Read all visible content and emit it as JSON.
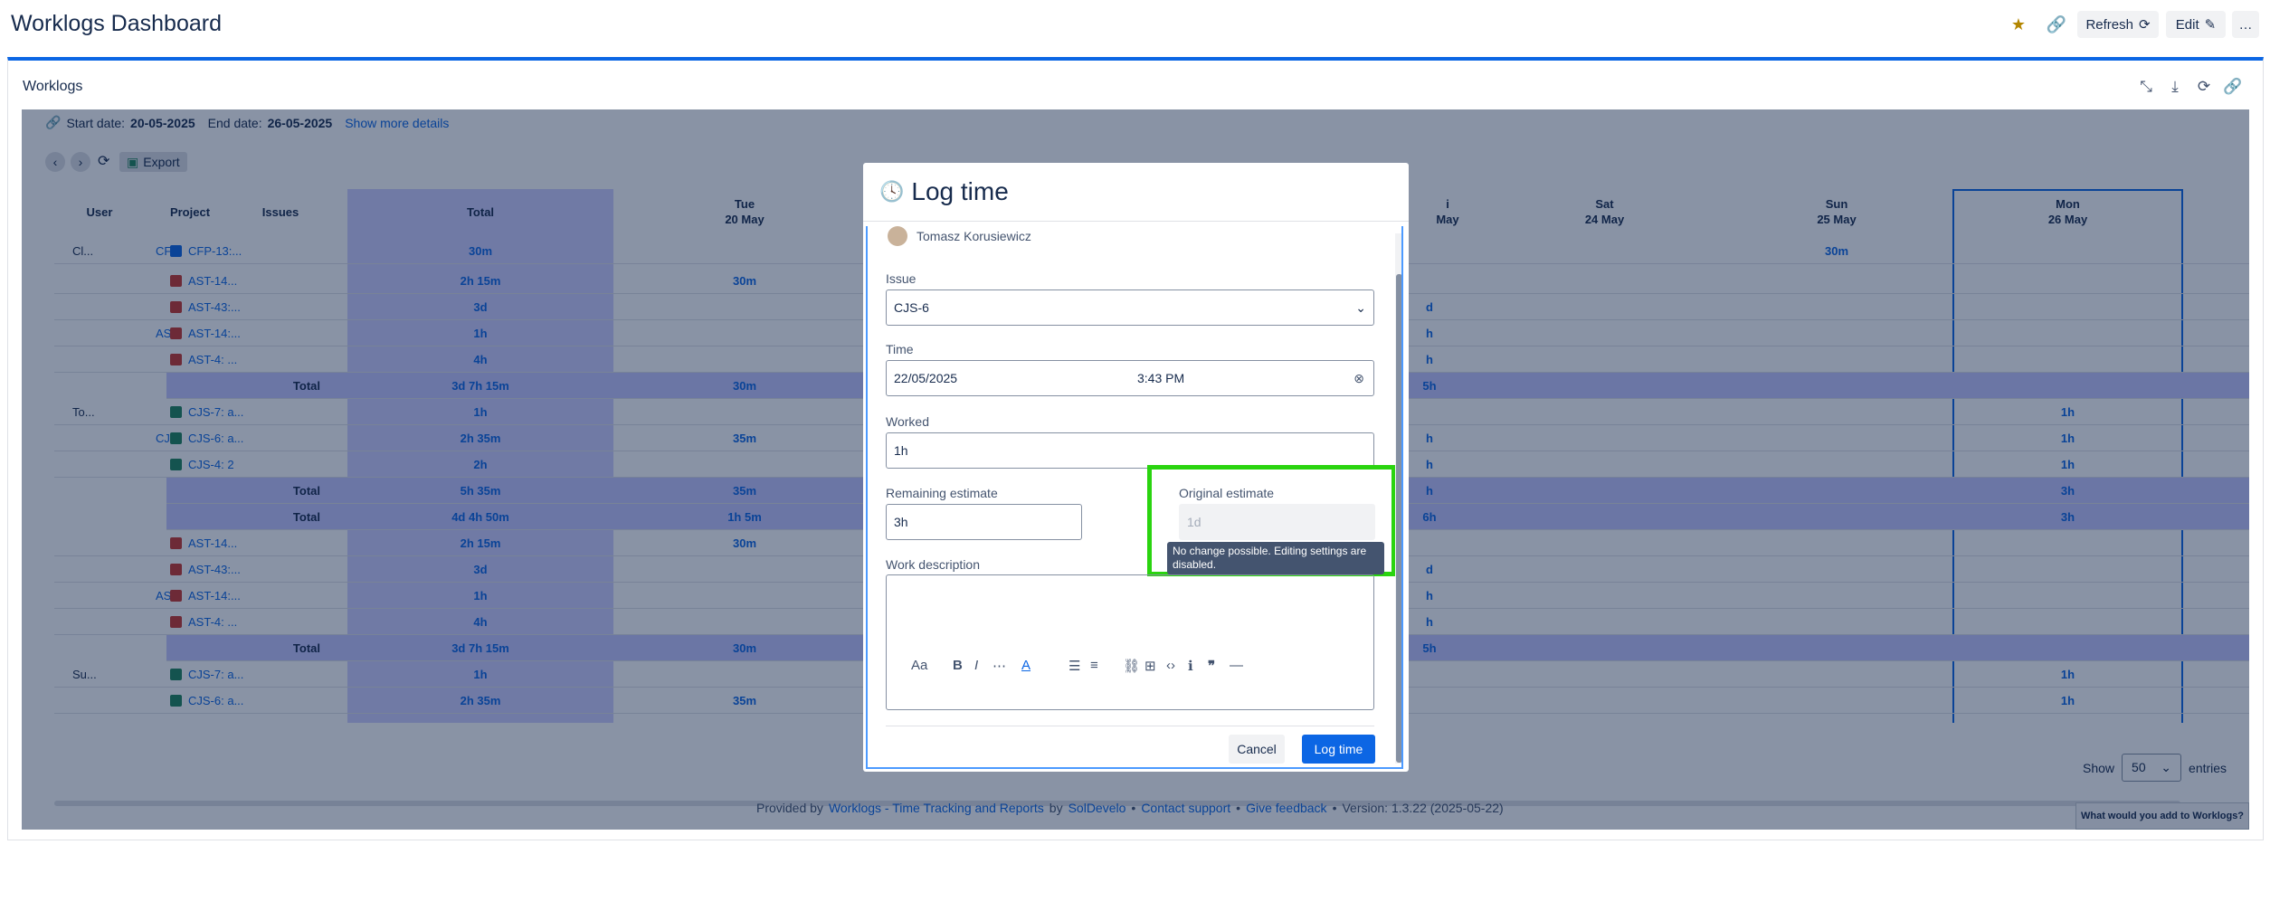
{
  "header": {
    "title": "Worklogs Dashboard",
    "refresh_label": "Refresh",
    "edit_label": "Edit",
    "more_label": "…"
  },
  "gadget": {
    "title": "Worklogs"
  },
  "filters": {
    "start_label": "Start date:",
    "start_value": "20-05-2025",
    "end_label": "End date:",
    "end_value": "26-05-2025",
    "show_more": "Show more details"
  },
  "toolbar": {
    "export_label": "Export"
  },
  "table": {
    "headers": [
      "User",
      "Project",
      "Issues",
      "Total",
      "Tue",
      "20 May",
      "Sat",
      "24 May",
      "Sun",
      "25 May",
      "Mon",
      "26 May"
    ],
    "rows": [
      {
        "user": "Cl...",
        "project": "CFP",
        "issue": "CFP-13:...",
        "total": "30m",
        "tue": "",
        "sun": "30m",
        "mon": ""
      },
      {
        "user": "",
        "project": "",
        "issue": "AST-14...",
        "total": "2h 15m",
        "tue": "30m",
        "sun": "",
        "mon": ""
      },
      {
        "user": "",
        "project": "",
        "issue": "AST-43:...",
        "total": "3d",
        "tue": "",
        "sun": "",
        "mon": ""
      },
      {
        "user": "",
        "project": "AST",
        "issue": "AST-14:...",
        "total": "1h",
        "tue": "",
        "sun": "",
        "mon": ""
      },
      {
        "user": "",
        "project": "",
        "issue": "AST-4: ...",
        "total": "4h",
        "tue": "",
        "sun": "",
        "mon": ""
      },
      {
        "user": "",
        "project": "",
        "issue": "Total",
        "total": "3d 7h 15m",
        "tue": "30m",
        "sun": "",
        "mon": ""
      },
      {
        "user": "To...",
        "project": "",
        "issue": "CJS-7: a...",
        "total": "1h",
        "tue": "",
        "sun": "",
        "mon": "1h"
      },
      {
        "user": "",
        "project": "CJS",
        "issue": "CJS-6: a...",
        "total": "2h 35m",
        "tue": "35m",
        "sun": "",
        "mon": "1h"
      },
      {
        "user": "",
        "project": "",
        "issue": "CJS-4: 2",
        "total": "2h",
        "tue": "",
        "sun": "",
        "mon": "1h"
      },
      {
        "user": "",
        "project": "",
        "issue": "Total",
        "total": "5h 35m",
        "tue": "35m",
        "sun": "",
        "mon": "3h"
      },
      {
        "user": "",
        "project": "",
        "issue": "Total",
        "total": "4d 4h 50m",
        "tue": "1h 5m",
        "sun": "",
        "mon": "3h"
      },
      {
        "user": "",
        "project": "",
        "issue": "AST-14...",
        "total": "2h 15m",
        "tue": "30m",
        "sun": "",
        "mon": ""
      },
      {
        "user": "",
        "project": "",
        "issue": "AST-43:...",
        "total": "3d",
        "tue": "",
        "sun": "",
        "mon": ""
      },
      {
        "user": "",
        "project": "AST",
        "issue": "AST-14:...",
        "total": "1h",
        "tue": "",
        "sun": "",
        "mon": ""
      },
      {
        "user": "",
        "project": "",
        "issue": "AST-4: ...",
        "total": "4h",
        "tue": "",
        "sun": "",
        "mon": ""
      },
      {
        "user": "",
        "project": "",
        "issue": "Total",
        "total": "3d 7h 15m",
        "tue": "30m",
        "sun": "",
        "mon": ""
      },
      {
        "user": "Su...",
        "project": "",
        "issue": "CJS-7: a...",
        "total": "1h",
        "tue": "",
        "sun": "",
        "mon": "1h"
      },
      {
        "user": "",
        "project": "",
        "issue": "CJS-6: a...",
        "total": "2h 35m",
        "tue": "35m",
        "sun": "",
        "mon": "1h"
      }
    ],
    "partial_col": {
      "header": "i",
      "header2": "May",
      "values": [
        "",
        "",
        "d",
        "h",
        "h",
        "5h",
        "",
        "h",
        "h",
        "h",
        "6h",
        "",
        "d",
        "h",
        "h",
        "5h",
        "",
        ""
      ]
    }
  },
  "pagination": {
    "show_label": "Show",
    "page_size": "50",
    "entries_label": "entries"
  },
  "footer": {
    "provided_by": "Provided by",
    "app_link": "Worklogs - Time Tracking and Reports",
    "by": "by",
    "vendor": "SolDevelo",
    "contact": "Contact support",
    "feedback": "Give feedback",
    "version": "Version: 1.3.22 (2025-05-22)",
    "sep": "•"
  },
  "feedback_tab": "What would you add to Worklogs?",
  "modal": {
    "title": "Log time",
    "author": "Tomasz Korusiewicz",
    "issue_label": "Issue",
    "issue_value": "CJS-6",
    "time_label": "Time",
    "date_value": "22/05/2025",
    "time_value": "3:43 PM",
    "worked_label": "Worked",
    "worked_value": "1h",
    "remaining_label": "Remaining estimate",
    "remaining_value": "3h",
    "original_label": "Original estimate",
    "original_placeholder": "1d",
    "tooltip": "No change possible. Editing settings are disabled.",
    "desc_label": "Work description",
    "font_btn": "Aa",
    "cancel_label": "Cancel",
    "submit_label": "Log time"
  },
  "colors": {
    "accent": "#0c66e4",
    "highlight": "#2ad40f",
    "overlay": "rgba(9,30,66,0.48)"
  }
}
